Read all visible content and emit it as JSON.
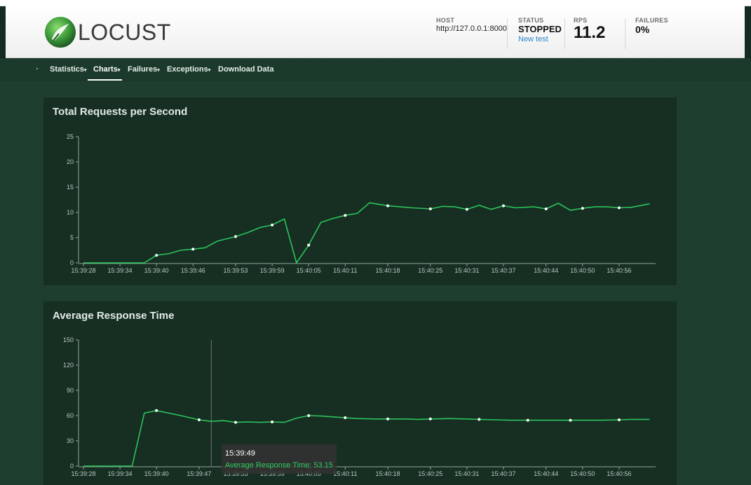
{
  "app": {
    "name": "LOCUST"
  },
  "header": {
    "host": {
      "label": "HOST",
      "value": "http://127.0.0.1:8000"
    },
    "status": {
      "label": "STATUS",
      "value": "STOPPED",
      "link": "New test"
    },
    "rps": {
      "label": "RPS",
      "value": "11.2"
    },
    "failures": {
      "label": "FAILURES",
      "value": "0%"
    }
  },
  "nav": {
    "items": [
      {
        "label": "Statistics",
        "active": false
      },
      {
        "label": "Charts",
        "active": true
      },
      {
        "label": "Failures",
        "active": false
      },
      {
        "label": "Exceptions",
        "active": false
      },
      {
        "label": "Download Data",
        "active": false
      }
    ]
  },
  "colors": {
    "line": "#2ac45a",
    "axis": "#8fa59a",
    "crosshair": "#8a8a8a"
  },
  "chart_data": [
    {
      "type": "line",
      "title": "Total Requests per Second",
      "ylim": [
        0,
        25
      ],
      "yticks": [
        0,
        5,
        10,
        15,
        20,
        25
      ],
      "xticks": [
        "15:39:28",
        "15:39:34",
        "15:39:40",
        "15:39:46",
        "15:39:53",
        "15:39:59",
        "15:40:05",
        "15:40:11",
        "15:40:18",
        "15:40:25",
        "15:40:31",
        "15:40:37",
        "15:40:44",
        "15:40:50",
        "15:40:56"
      ],
      "x_range": [
        "15:39:28",
        "15:41:02"
      ],
      "grid": false,
      "x": [
        "15:39:28",
        "15:39:30",
        "15:39:32",
        "15:39:34",
        "15:39:36",
        "15:39:38",
        "15:39:40",
        "15:39:42",
        "15:39:44",
        "15:39:46",
        "15:39:48",
        "15:39:50",
        "15:39:53",
        "15:39:55",
        "15:39:57",
        "15:39:59",
        "15:40:01",
        "15:40:03",
        "15:40:05",
        "15:40:07",
        "15:40:09",
        "15:40:11",
        "15:40:13",
        "15:40:15",
        "15:40:18",
        "15:40:20",
        "15:40:22",
        "15:40:25",
        "15:40:27",
        "15:40:29",
        "15:40:31",
        "15:40:33",
        "15:40:35",
        "15:40:37",
        "15:40:39",
        "15:40:42",
        "15:40:44",
        "15:40:46",
        "15:40:48",
        "15:40:50",
        "15:40:52",
        "15:40:54",
        "15:40:56",
        "15:40:58",
        "15:41:01"
      ],
      "values": [
        0,
        0,
        0,
        0,
        0,
        0,
        1.5,
        1.8,
        2.5,
        2.7,
        3.0,
        4.3,
        5.2,
        6.0,
        7.0,
        7.5,
        8.7,
        0,
        3.5,
        8.0,
        8.8,
        9.4,
        9.8,
        11.9,
        11.3,
        11.1,
        10.9,
        10.7,
        11.2,
        11.1,
        10.6,
        11.4,
        10.6,
        11.3,
        10.9,
        11.1,
        10.7,
        11.8,
        10.4,
        10.8,
        11.1,
        11.1,
        10.9,
        11.0,
        11.7
      ],
      "markers": [
        6,
        9,
        12,
        15,
        18,
        21,
        24,
        27,
        30,
        33,
        36,
        39,
        42
      ]
    },
    {
      "type": "line",
      "title": "Average Response Time",
      "ylim": [
        0,
        150
      ],
      "yticks": [
        0,
        30,
        60,
        90,
        120,
        150
      ],
      "xticks": [
        "15:39:28",
        "15:39:34",
        "15:39:40",
        "15:39:47",
        "15:39:53",
        "15:39:59",
        "15:40:05",
        "15:40:11",
        "15:40:18",
        "15:40:25",
        "15:40:31",
        "15:40:37",
        "15:40:44",
        "15:40:50",
        "15:40:56"
      ],
      "x_range": [
        "15:39:28",
        "15:41:02"
      ],
      "grid": false,
      "x": [
        "15:39:28",
        "15:39:30",
        "15:39:32",
        "15:39:34",
        "15:39:36",
        "15:39:38",
        "15:39:40",
        "15:39:42",
        "15:39:44",
        "15:39:47",
        "15:39:49",
        "15:39:51",
        "15:39:53",
        "15:39:55",
        "15:39:57",
        "15:39:59",
        "15:40:01",
        "15:40:03",
        "15:40:05",
        "15:40:07",
        "15:40:09",
        "15:40:11",
        "15:40:13",
        "15:40:16",
        "15:40:18",
        "15:40:21",
        "15:40:23",
        "15:40:25",
        "15:40:28",
        "15:40:31",
        "15:40:33",
        "15:40:36",
        "15:40:38",
        "15:40:41",
        "15:40:43",
        "15:40:46",
        "15:40:48",
        "15:40:51",
        "15:40:53",
        "15:40:56",
        "15:40:58",
        "15:41:01"
      ],
      "values": [
        0,
        0,
        0,
        0,
        0,
        63,
        66,
        63,
        60,
        55,
        53.15,
        54,
        52,
        52.5,
        52,
        52.5,
        52,
        57,
        60,
        59.5,
        58.5,
        57.5,
        56.5,
        56,
        56,
        56,
        55.5,
        56,
        56.5,
        56,
        55.5,
        55,
        54.5,
        54.5,
        54.5,
        54.5,
        54.5,
        54.5,
        54.5,
        55,
        55.5,
        55.5
      ],
      "markers": [
        6,
        9,
        12,
        15,
        18,
        21,
        24,
        27,
        30,
        33,
        36,
        39,
        42
      ],
      "tooltip": {
        "time": "15:39:49",
        "text": "Average Response Time: 53.15",
        "index": 10
      }
    }
  ]
}
